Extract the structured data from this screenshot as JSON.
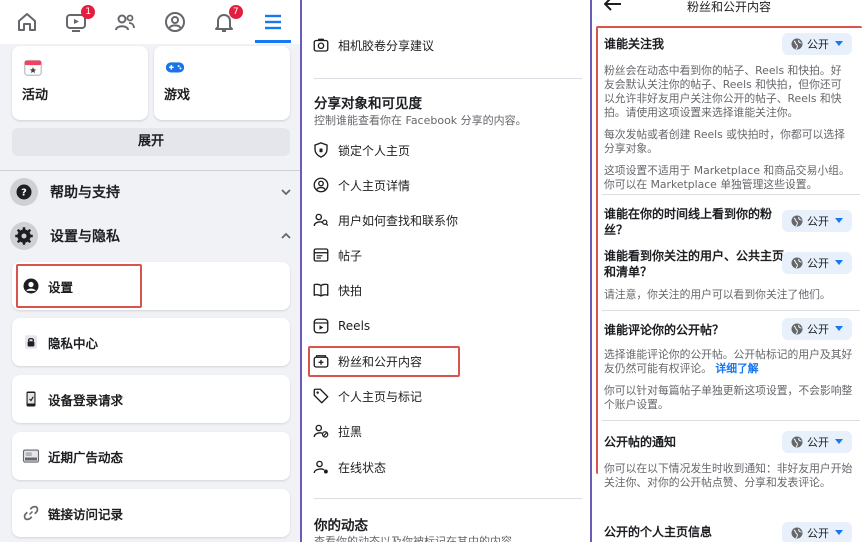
{
  "panel1": {
    "topbar": {
      "icons": [
        "home-icon",
        "video-icon",
        "friends-icon",
        "profile-icon",
        "bell-icon",
        "menu-icon"
      ],
      "video_badge": "1",
      "bell_badge": "7"
    },
    "shortcuts": [
      {
        "label": "活动",
        "icon": "calendar-icon"
      },
      {
        "label": "游戏",
        "icon": "gamepad-icon"
      }
    ],
    "expand_label": "展开",
    "sections": [
      {
        "label": "帮助与支持",
        "icon": "question-icon"
      },
      {
        "label": "设置与隐私",
        "icon": "gear-icon"
      }
    ],
    "items": [
      {
        "label": "设置",
        "icon": "account-icon"
      },
      {
        "label": "隐私中心",
        "icon": "lock-icon"
      },
      {
        "label": "设备登录请求",
        "icon": "device-icon"
      },
      {
        "label": "近期广告动态",
        "icon": "ads-icon"
      },
      {
        "label": "链接访问记录",
        "icon": "link-icon"
      }
    ]
  },
  "panel2": {
    "top_item": "相机胶卷分享建议",
    "section_title": "分享对象和可见度",
    "section_sub": "控制谁能查看你在 Facebook 分享的内容。",
    "items": [
      {
        "label": "锁定个人主页",
        "icon": "shield-icon"
      },
      {
        "label": "个人主页详情",
        "icon": "user-circle-icon"
      },
      {
        "label": "用户如何查找和联系你",
        "icon": "user-search-icon"
      },
      {
        "label": "帖子",
        "icon": "post-icon"
      },
      {
        "label": "快拍",
        "icon": "book-icon"
      },
      {
        "label": "Reels",
        "icon": "reels-icon"
      },
      {
        "label": "粉丝和公开内容",
        "icon": "followers-icon"
      },
      {
        "label": "个人主页与标记",
        "icon": "tag-icon"
      },
      {
        "label": "拉黑",
        "icon": "block-user-icon"
      },
      {
        "label": "在线状态",
        "icon": "online-status-icon"
      }
    ],
    "bottom_title": "你的动态",
    "bottom_sub": "查看你的动态以及你被标记在其中的内容"
  },
  "panel3": {
    "title": "粉丝和公开内容",
    "pill_label": "公开",
    "blocks": [
      {
        "title": "谁能关注我",
        "desc": [
          "粉丝会在动态中看到你的帖子、Reels 和快拍。好友会默认关注你的帖子、Reels 和快拍，但你还可以允许非好友用户关注你公开的帖子、Reels 和快拍。请使用这项设置来选择谁能关注你。",
          "每次发帖或者创建 Reels 或快拍时，你都可以选择分享对象。",
          "这项设置不适用于 Marketplace 和商品交易小组。你可以在 Marketplace 单独管理这些设置。"
        ]
      },
      {
        "title": "谁能在你的时间线上看到你的粉丝？",
        "desc": []
      },
      {
        "title": "谁能看到你关注的用户、公共主页和清单？",
        "desc": [
          "请注意，你关注的用户可以看到你关注了他们。"
        ]
      },
      {
        "title": "谁能评论你的公开帖？",
        "desc": [
          "选择谁能评论你的公开帖。公开帖标记的用户及其好友仍然可能有权评论。",
          "你可以针对每篇帖子单独更新这项设置，不会影响整个账户设置。"
        ],
        "link": "详细了解"
      },
      {
        "title": "公开帖的通知",
        "desc": [
          "你可以在以下情况发生时收到通知：非好友用户开始关注你、对你的公开帖点赞、分享和发表评论。"
        ]
      },
      {
        "title": "公开的个人主页信息",
        "desc": []
      }
    ]
  },
  "colors": {
    "accent": "#1877f2",
    "highlight": "#d9534f",
    "divider_purple": "#6e5bb8"
  }
}
